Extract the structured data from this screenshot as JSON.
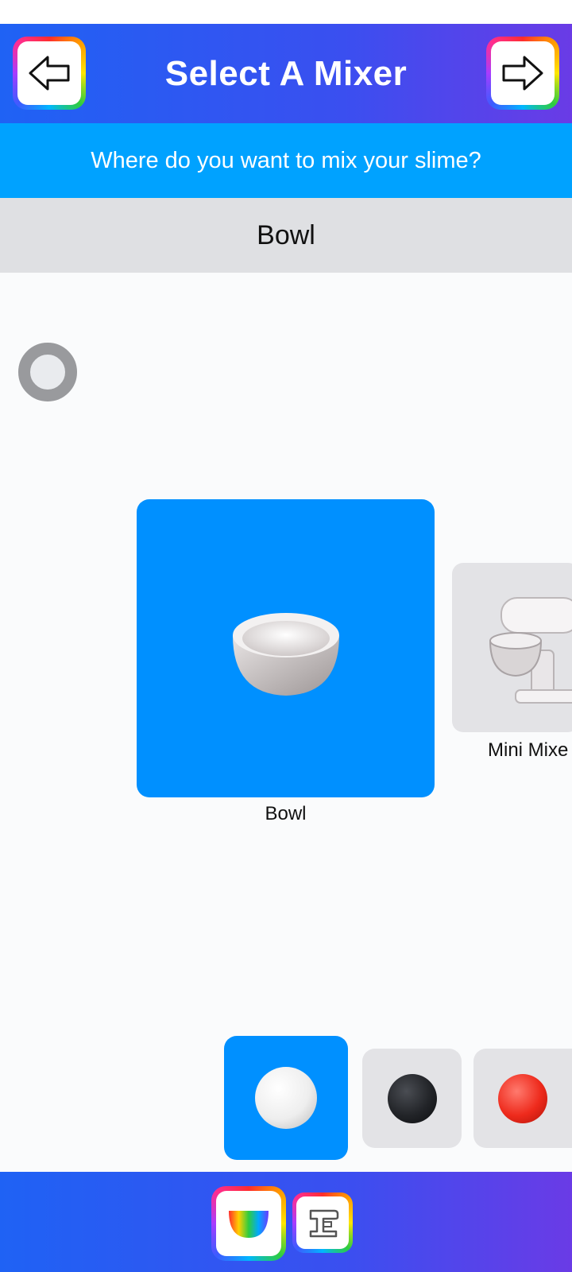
{
  "header": {
    "title": "Select A Mixer",
    "back_icon": "arrow-left-icon",
    "next_icon": "arrow-right-icon"
  },
  "prompt": "Where do you want to mix your slime?",
  "selected_name": "Bowl",
  "mixers": [
    {
      "label": "Bowl",
      "icon": "bowl-icon",
      "selected": true
    },
    {
      "label": "Mini Mixe",
      "icon": "stand-mixer-icon",
      "selected": false
    }
  ],
  "colors": {
    "accent": "#0090ff",
    "subheader": "#00a2ff",
    "options": [
      {
        "name": "white",
        "hex": "#f2f2f2",
        "selected": true
      },
      {
        "name": "black",
        "hex": "#222428",
        "selected": false
      },
      {
        "name": "red",
        "hex": "#ee2a1c",
        "selected": false
      }
    ]
  },
  "footer": {
    "tabs": [
      {
        "icon": "rainbow-bowl-icon",
        "selected": true
      },
      {
        "icon": "mixer-outline-icon",
        "selected": false
      }
    ]
  }
}
